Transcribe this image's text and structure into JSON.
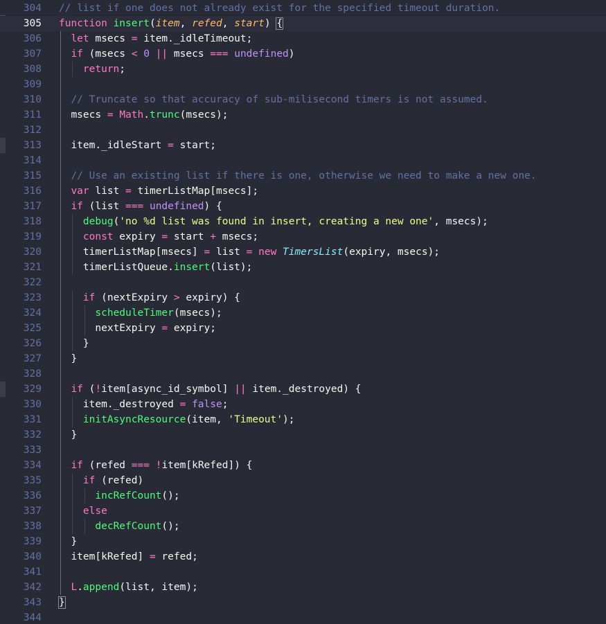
{
  "editor": {
    "active_line": 305,
    "theme_colors": {
      "background": "#282a36",
      "line_number": "#6272a4",
      "line_number_active": "#f8f8f2",
      "text": "#f8f8f2",
      "comment": "#6272a4",
      "keyword": "#ff79c6",
      "function": "#50fa7b",
      "string": "#f1fa8c",
      "parameter": "#ffb86c",
      "number": "#bd93f9",
      "class": "#8be9fd"
    },
    "lines": [
      {
        "num": "304",
        "indent": 0,
        "tokens": [
          {
            "t": "// list if one does not already exist for the specified timeout duration.",
            "c": "comment"
          }
        ]
      },
      {
        "num": "305",
        "indent": 0,
        "tokens": [
          {
            "t": "function",
            "c": "keyword"
          },
          {
            "t": " ",
            "c": "text"
          },
          {
            "t": "insert",
            "c": "function"
          },
          {
            "t": "(",
            "c": "text"
          },
          {
            "t": "item",
            "c": "parameter"
          },
          {
            "t": ", ",
            "c": "text"
          },
          {
            "t": "refed",
            "c": "parameter"
          },
          {
            "t": ", ",
            "c": "text"
          },
          {
            "t": "start",
            "c": "parameter"
          },
          {
            "t": ") ",
            "c": "text"
          },
          {
            "t": "{",
            "c": "text",
            "box": true
          }
        ]
      },
      {
        "num": "306",
        "indent": 1,
        "tokens": [
          {
            "t": "let",
            "c": "keyword"
          },
          {
            "t": " msecs ",
            "c": "text"
          },
          {
            "t": "=",
            "c": "keyword"
          },
          {
            "t": " item._idleTimeout;",
            "c": "text"
          }
        ]
      },
      {
        "num": "307",
        "indent": 1,
        "tokens": [
          {
            "t": "if",
            "c": "keyword"
          },
          {
            "t": " (msecs ",
            "c": "text"
          },
          {
            "t": "<",
            "c": "keyword"
          },
          {
            "t": " ",
            "c": "text"
          },
          {
            "t": "0",
            "c": "number"
          },
          {
            "t": " ",
            "c": "text"
          },
          {
            "t": "||",
            "c": "keyword"
          },
          {
            "t": " msecs ",
            "c": "text"
          },
          {
            "t": "===",
            "c": "keyword"
          },
          {
            "t": " ",
            "c": "text"
          },
          {
            "t": "undefined",
            "c": "number"
          },
          {
            "t": ")",
            "c": "text"
          }
        ]
      },
      {
        "num": "308",
        "indent": 2,
        "tokens": [
          {
            "t": "return",
            "c": "keyword"
          },
          {
            "t": ";",
            "c": "text"
          }
        ]
      },
      {
        "num": "309",
        "indent": 0,
        "tokens": []
      },
      {
        "num": "310",
        "indent": 1,
        "tokens": [
          {
            "t": "// Truncate so that accuracy of sub-milisecond timers is not assumed.",
            "c": "comment"
          }
        ]
      },
      {
        "num": "311",
        "indent": 1,
        "tokens": [
          {
            "t": "msecs ",
            "c": "text"
          },
          {
            "t": "=",
            "c": "keyword"
          },
          {
            "t": " ",
            "c": "text"
          },
          {
            "t": "Math",
            "c": "keyword"
          },
          {
            "t": ".",
            "c": "text"
          },
          {
            "t": "trunc",
            "c": "function"
          },
          {
            "t": "(msecs);",
            "c": "text"
          }
        ]
      },
      {
        "num": "312",
        "indent": 0,
        "tokens": []
      },
      {
        "num": "313",
        "indent": 1,
        "tokens": [
          {
            "t": "item._idleStart ",
            "c": "text"
          },
          {
            "t": "=",
            "c": "keyword"
          },
          {
            "t": " start;",
            "c": "text"
          }
        ]
      },
      {
        "num": "314",
        "indent": 0,
        "tokens": []
      },
      {
        "num": "315",
        "indent": 1,
        "tokens": [
          {
            "t": "// Use an existing list if there is one, otherwise we need to make a new one.",
            "c": "comment"
          }
        ]
      },
      {
        "num": "316",
        "indent": 1,
        "tokens": [
          {
            "t": "var",
            "c": "keyword"
          },
          {
            "t": " list ",
            "c": "text"
          },
          {
            "t": "=",
            "c": "keyword"
          },
          {
            "t": " timerListMap[msecs];",
            "c": "text"
          }
        ]
      },
      {
        "num": "317",
        "indent": 1,
        "tokens": [
          {
            "t": "if",
            "c": "keyword"
          },
          {
            "t": " (list ",
            "c": "text"
          },
          {
            "t": "===",
            "c": "keyword"
          },
          {
            "t": " ",
            "c": "text"
          },
          {
            "t": "undefined",
            "c": "number"
          },
          {
            "t": ") {",
            "c": "text"
          }
        ]
      },
      {
        "num": "318",
        "indent": 2,
        "tokens": [
          {
            "t": "debug",
            "c": "function"
          },
          {
            "t": "(",
            "c": "text"
          },
          {
            "t": "'no %d list was found in insert, creating a new one'",
            "c": "string"
          },
          {
            "t": ", msecs);",
            "c": "text"
          }
        ]
      },
      {
        "num": "319",
        "indent": 2,
        "tokens": [
          {
            "t": "const",
            "c": "keyword"
          },
          {
            "t": " expiry ",
            "c": "text"
          },
          {
            "t": "=",
            "c": "keyword"
          },
          {
            "t": " start ",
            "c": "text"
          },
          {
            "t": "+",
            "c": "keyword"
          },
          {
            "t": " msecs;",
            "c": "text"
          }
        ]
      },
      {
        "num": "320",
        "indent": 2,
        "tokens": [
          {
            "t": "timerListMap[msecs] ",
            "c": "text"
          },
          {
            "t": "=",
            "c": "keyword"
          },
          {
            "t": " list ",
            "c": "text"
          },
          {
            "t": "=",
            "c": "keyword"
          },
          {
            "t": " ",
            "c": "text"
          },
          {
            "t": "new",
            "c": "keyword"
          },
          {
            "t": " ",
            "c": "text"
          },
          {
            "t": "TimersList",
            "c": "class"
          },
          {
            "t": "(expiry, msecs);",
            "c": "text"
          }
        ]
      },
      {
        "num": "321",
        "indent": 2,
        "tokens": [
          {
            "t": "timerListQueue.",
            "c": "text"
          },
          {
            "t": "insert",
            "c": "function"
          },
          {
            "t": "(list);",
            "c": "text"
          }
        ]
      },
      {
        "num": "322",
        "indent": 0,
        "tokens": []
      },
      {
        "num": "323",
        "indent": 2,
        "tokens": [
          {
            "t": "if",
            "c": "keyword"
          },
          {
            "t": " (nextExpiry ",
            "c": "text"
          },
          {
            "t": ">",
            "c": "keyword"
          },
          {
            "t": " expiry) {",
            "c": "text"
          }
        ]
      },
      {
        "num": "324",
        "indent": 3,
        "tokens": [
          {
            "t": "scheduleTimer",
            "c": "function"
          },
          {
            "t": "(msecs);",
            "c": "text"
          }
        ]
      },
      {
        "num": "325",
        "indent": 3,
        "tokens": [
          {
            "t": "nextExpiry ",
            "c": "text"
          },
          {
            "t": "=",
            "c": "keyword"
          },
          {
            "t": " expiry;",
            "c": "text"
          }
        ]
      },
      {
        "num": "326",
        "indent": 2,
        "tokens": [
          {
            "t": "}",
            "c": "text"
          }
        ]
      },
      {
        "num": "327",
        "indent": 1,
        "tokens": [
          {
            "t": "}",
            "c": "text"
          }
        ]
      },
      {
        "num": "328",
        "indent": 0,
        "tokens": []
      },
      {
        "num": "329",
        "indent": 1,
        "tokens": [
          {
            "t": "if",
            "c": "keyword"
          },
          {
            "t": " (",
            "c": "text"
          },
          {
            "t": "!",
            "c": "keyword"
          },
          {
            "t": "item[async_id_symbol] ",
            "c": "text"
          },
          {
            "t": "||",
            "c": "keyword"
          },
          {
            "t": " item._destroyed) {",
            "c": "text"
          }
        ]
      },
      {
        "num": "330",
        "indent": 2,
        "tokens": [
          {
            "t": "item._destroyed ",
            "c": "text"
          },
          {
            "t": "=",
            "c": "keyword"
          },
          {
            "t": " ",
            "c": "text"
          },
          {
            "t": "false",
            "c": "number"
          },
          {
            "t": ";",
            "c": "text"
          }
        ]
      },
      {
        "num": "331",
        "indent": 2,
        "tokens": [
          {
            "t": "initAsyncResource",
            "c": "function"
          },
          {
            "t": "(item, ",
            "c": "text"
          },
          {
            "t": "'Timeout'",
            "c": "string"
          },
          {
            "t": ");",
            "c": "text"
          }
        ]
      },
      {
        "num": "332",
        "indent": 1,
        "tokens": [
          {
            "t": "}",
            "c": "text"
          }
        ]
      },
      {
        "num": "333",
        "indent": 0,
        "tokens": []
      },
      {
        "num": "334",
        "indent": 1,
        "tokens": [
          {
            "t": "if",
            "c": "keyword"
          },
          {
            "t": " (refed ",
            "c": "text"
          },
          {
            "t": "===",
            "c": "keyword"
          },
          {
            "t": " ",
            "c": "text"
          },
          {
            "t": "!",
            "c": "keyword"
          },
          {
            "t": "item[kRefed]) {",
            "c": "text"
          }
        ]
      },
      {
        "num": "335",
        "indent": 2,
        "tokens": [
          {
            "t": "if",
            "c": "keyword"
          },
          {
            "t": " (refed)",
            "c": "text"
          }
        ]
      },
      {
        "num": "336",
        "indent": 3,
        "tokens": [
          {
            "t": "incRefCount",
            "c": "function"
          },
          {
            "t": "();",
            "c": "text"
          }
        ]
      },
      {
        "num": "337",
        "indent": 2,
        "tokens": [
          {
            "t": "else",
            "c": "keyword"
          }
        ]
      },
      {
        "num": "338",
        "indent": 3,
        "tokens": [
          {
            "t": "decRefCount",
            "c": "function"
          },
          {
            "t": "();",
            "c": "text"
          }
        ]
      },
      {
        "num": "339",
        "indent": 1,
        "tokens": [
          {
            "t": "}",
            "c": "text"
          }
        ]
      },
      {
        "num": "340",
        "indent": 1,
        "tokens": [
          {
            "t": "item[kRefed] ",
            "c": "text"
          },
          {
            "t": "=",
            "c": "keyword"
          },
          {
            "t": " refed;",
            "c": "text"
          }
        ]
      },
      {
        "num": "341",
        "indent": 0,
        "tokens": []
      },
      {
        "num": "342",
        "indent": 1,
        "tokens": [
          {
            "t": "L",
            "c": "keyword"
          },
          {
            "t": ".",
            "c": "text"
          },
          {
            "t": "append",
            "c": "function"
          },
          {
            "t": "(list, item);",
            "c": "text"
          }
        ]
      },
      {
        "num": "343",
        "indent": 0,
        "tokens": [
          {
            "t": "}",
            "c": "text",
            "box": true
          }
        ]
      },
      {
        "num": "344",
        "indent": 0,
        "tokens": []
      }
    ]
  }
}
